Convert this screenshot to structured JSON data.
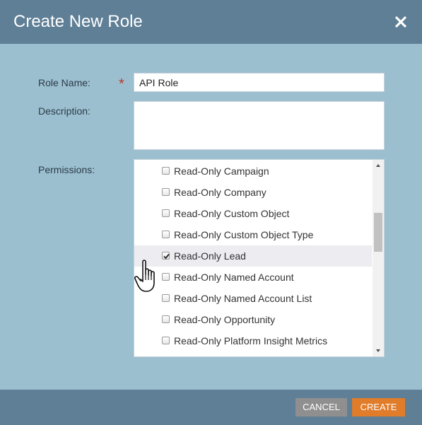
{
  "dialog": {
    "title": "Create New Role",
    "close_icon": "close-x-icon"
  },
  "form": {
    "role_name_label": "Role Name:",
    "required_marker": "*",
    "role_name_value": "API Role",
    "description_label": "Description:",
    "description_value": "",
    "permissions_label": "Permissions:"
  },
  "permissions": [
    {
      "label": "Read-Only Campaign",
      "checked": false
    },
    {
      "label": "Read-Only Company",
      "checked": false
    },
    {
      "label": "Read-Only Custom Object",
      "checked": false
    },
    {
      "label": "Read-Only Custom Object Type",
      "checked": false
    },
    {
      "label": "Read-Only Lead",
      "checked": true
    },
    {
      "label": "Read-Only Named Account",
      "checked": false
    },
    {
      "label": "Read-Only Named Account List",
      "checked": false
    },
    {
      "label": "Read-Only Opportunity",
      "checked": false
    },
    {
      "label": "Read-Only Platform Insight Metrics",
      "checked": false
    }
  ],
  "footer": {
    "cancel_label": "CANCEL",
    "create_label": "CREATE"
  },
  "colors": {
    "header": "#5f7f96",
    "body": "#9cbfd0",
    "create_button": "#e07c2a",
    "cancel_button": "#8f8f8f"
  }
}
